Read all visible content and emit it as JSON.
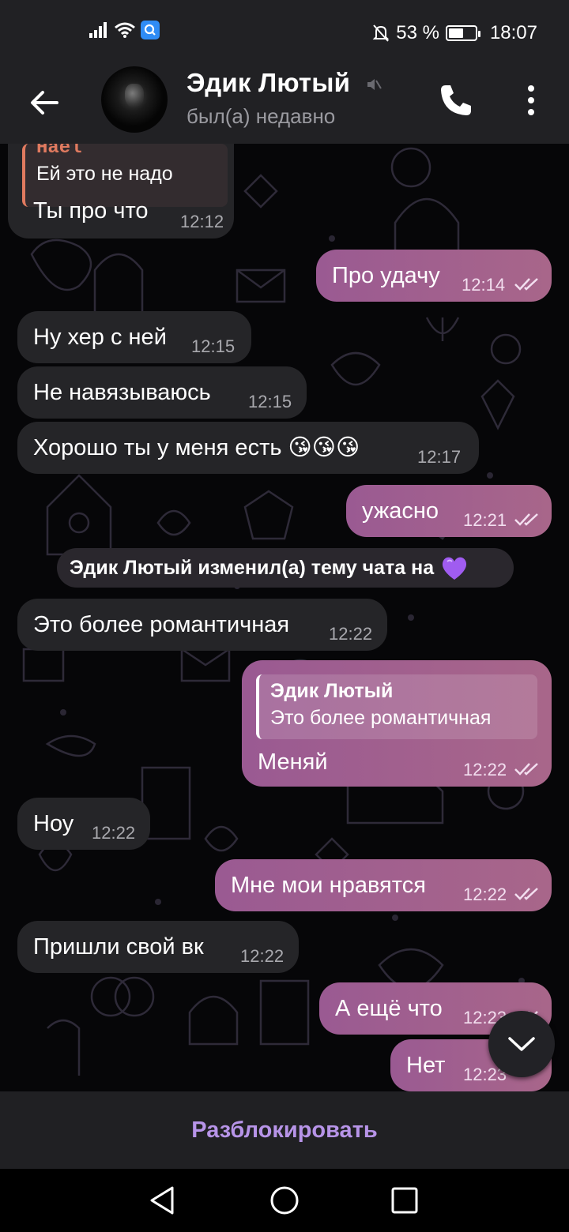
{
  "status_bar": {
    "notif_icons": [
      "signal-icon",
      "wifi-icon",
      "app-notification-icon"
    ],
    "battery": "53 %",
    "time": "18:07"
  },
  "header": {
    "contact_name": "Эдик Лютый",
    "last_seen": "был(а) недавно"
  },
  "messages": [
    {
      "dir": "in",
      "reply_author": "Hael",
      "reply_text": "Ей это не надо",
      "text": "Ты про что",
      "time": "12:12"
    },
    {
      "dir": "out",
      "text": "Про удачу",
      "time": "12:14"
    },
    {
      "dir": "in",
      "text": "Ну хер с ней",
      "time": "12:15"
    },
    {
      "dir": "in",
      "text": "Не навязываюсь",
      "time": "12:15"
    },
    {
      "dir": "in",
      "text": "Хорошо ты у меня есть 😘😘😘",
      "time": "12:17"
    },
    {
      "dir": "out",
      "text": "ужасно",
      "time": "12:21"
    },
    {
      "dir": "in",
      "text": "Это более романтичная",
      "time": "12:22"
    },
    {
      "dir": "out",
      "reply_author": "Эдик Лютый",
      "reply_text": "Это более романтичная",
      "text": "Меняй",
      "time": "12:22"
    },
    {
      "dir": "in",
      "text": "Ноу",
      "time": "12:22"
    },
    {
      "dir": "out",
      "text": "Мне мои нравятся",
      "time": "12:22"
    },
    {
      "dir": "in",
      "text": "Пришли свой вк",
      "time": "12:22"
    },
    {
      "dir": "out",
      "text": "А ещё что",
      "time": "12:23"
    },
    {
      "dir": "out",
      "text": "Нет",
      "time": "12:23"
    }
  ],
  "service_message": "Эдик Лютый изменил(а) тему чата на",
  "service_emoji": "purple-heart-icon",
  "bottom": {
    "unblock_label": "Разблокировать"
  },
  "colors": {
    "accent": "#b794e8",
    "outgoing_bubble": "#a8668a",
    "incoming_bubble": "#252528",
    "header_bg": "#212124"
  }
}
